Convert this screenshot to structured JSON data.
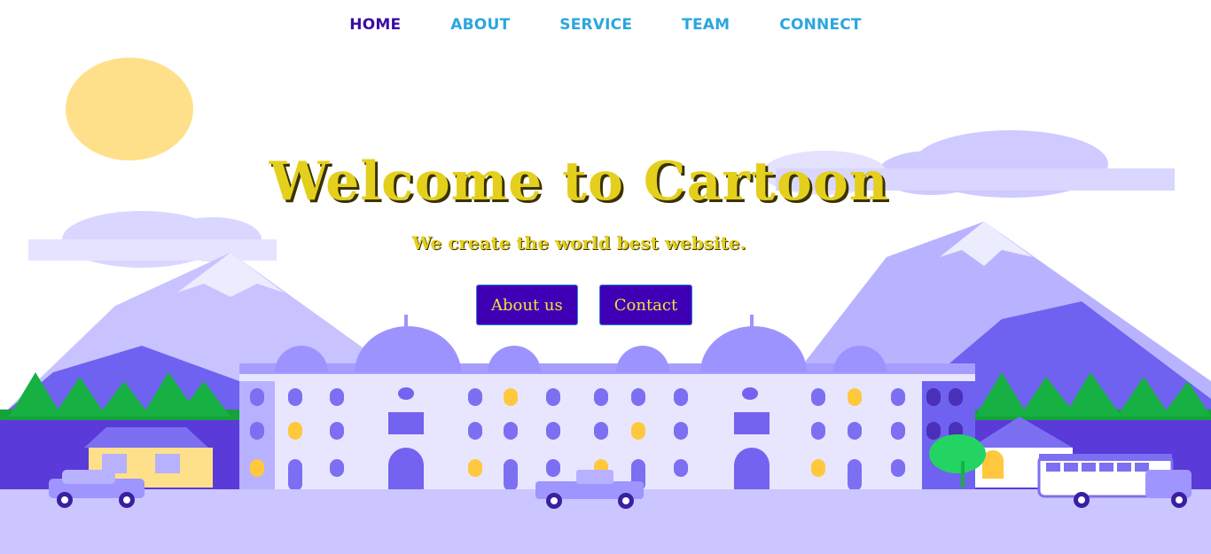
{
  "nav": {
    "items": [
      {
        "label": "HOME",
        "active": true
      },
      {
        "label": "ABOUT",
        "active": false
      },
      {
        "label": "SERVICE",
        "active": false
      },
      {
        "label": "TEAM",
        "active": false
      },
      {
        "label": "CONNECT",
        "active": false
      }
    ]
  },
  "hero": {
    "title": "Welcome to Cartoon",
    "subtitle": "We create the world best website.",
    "buttons": {
      "about": "About us",
      "contact": "Contact"
    }
  },
  "colors": {
    "nav_active": "#3a0ca3",
    "nav_link": "#2ba6de",
    "title": "#e4cf1c",
    "button_bg": "#3f00b5",
    "button_text": "#f4e03a"
  }
}
